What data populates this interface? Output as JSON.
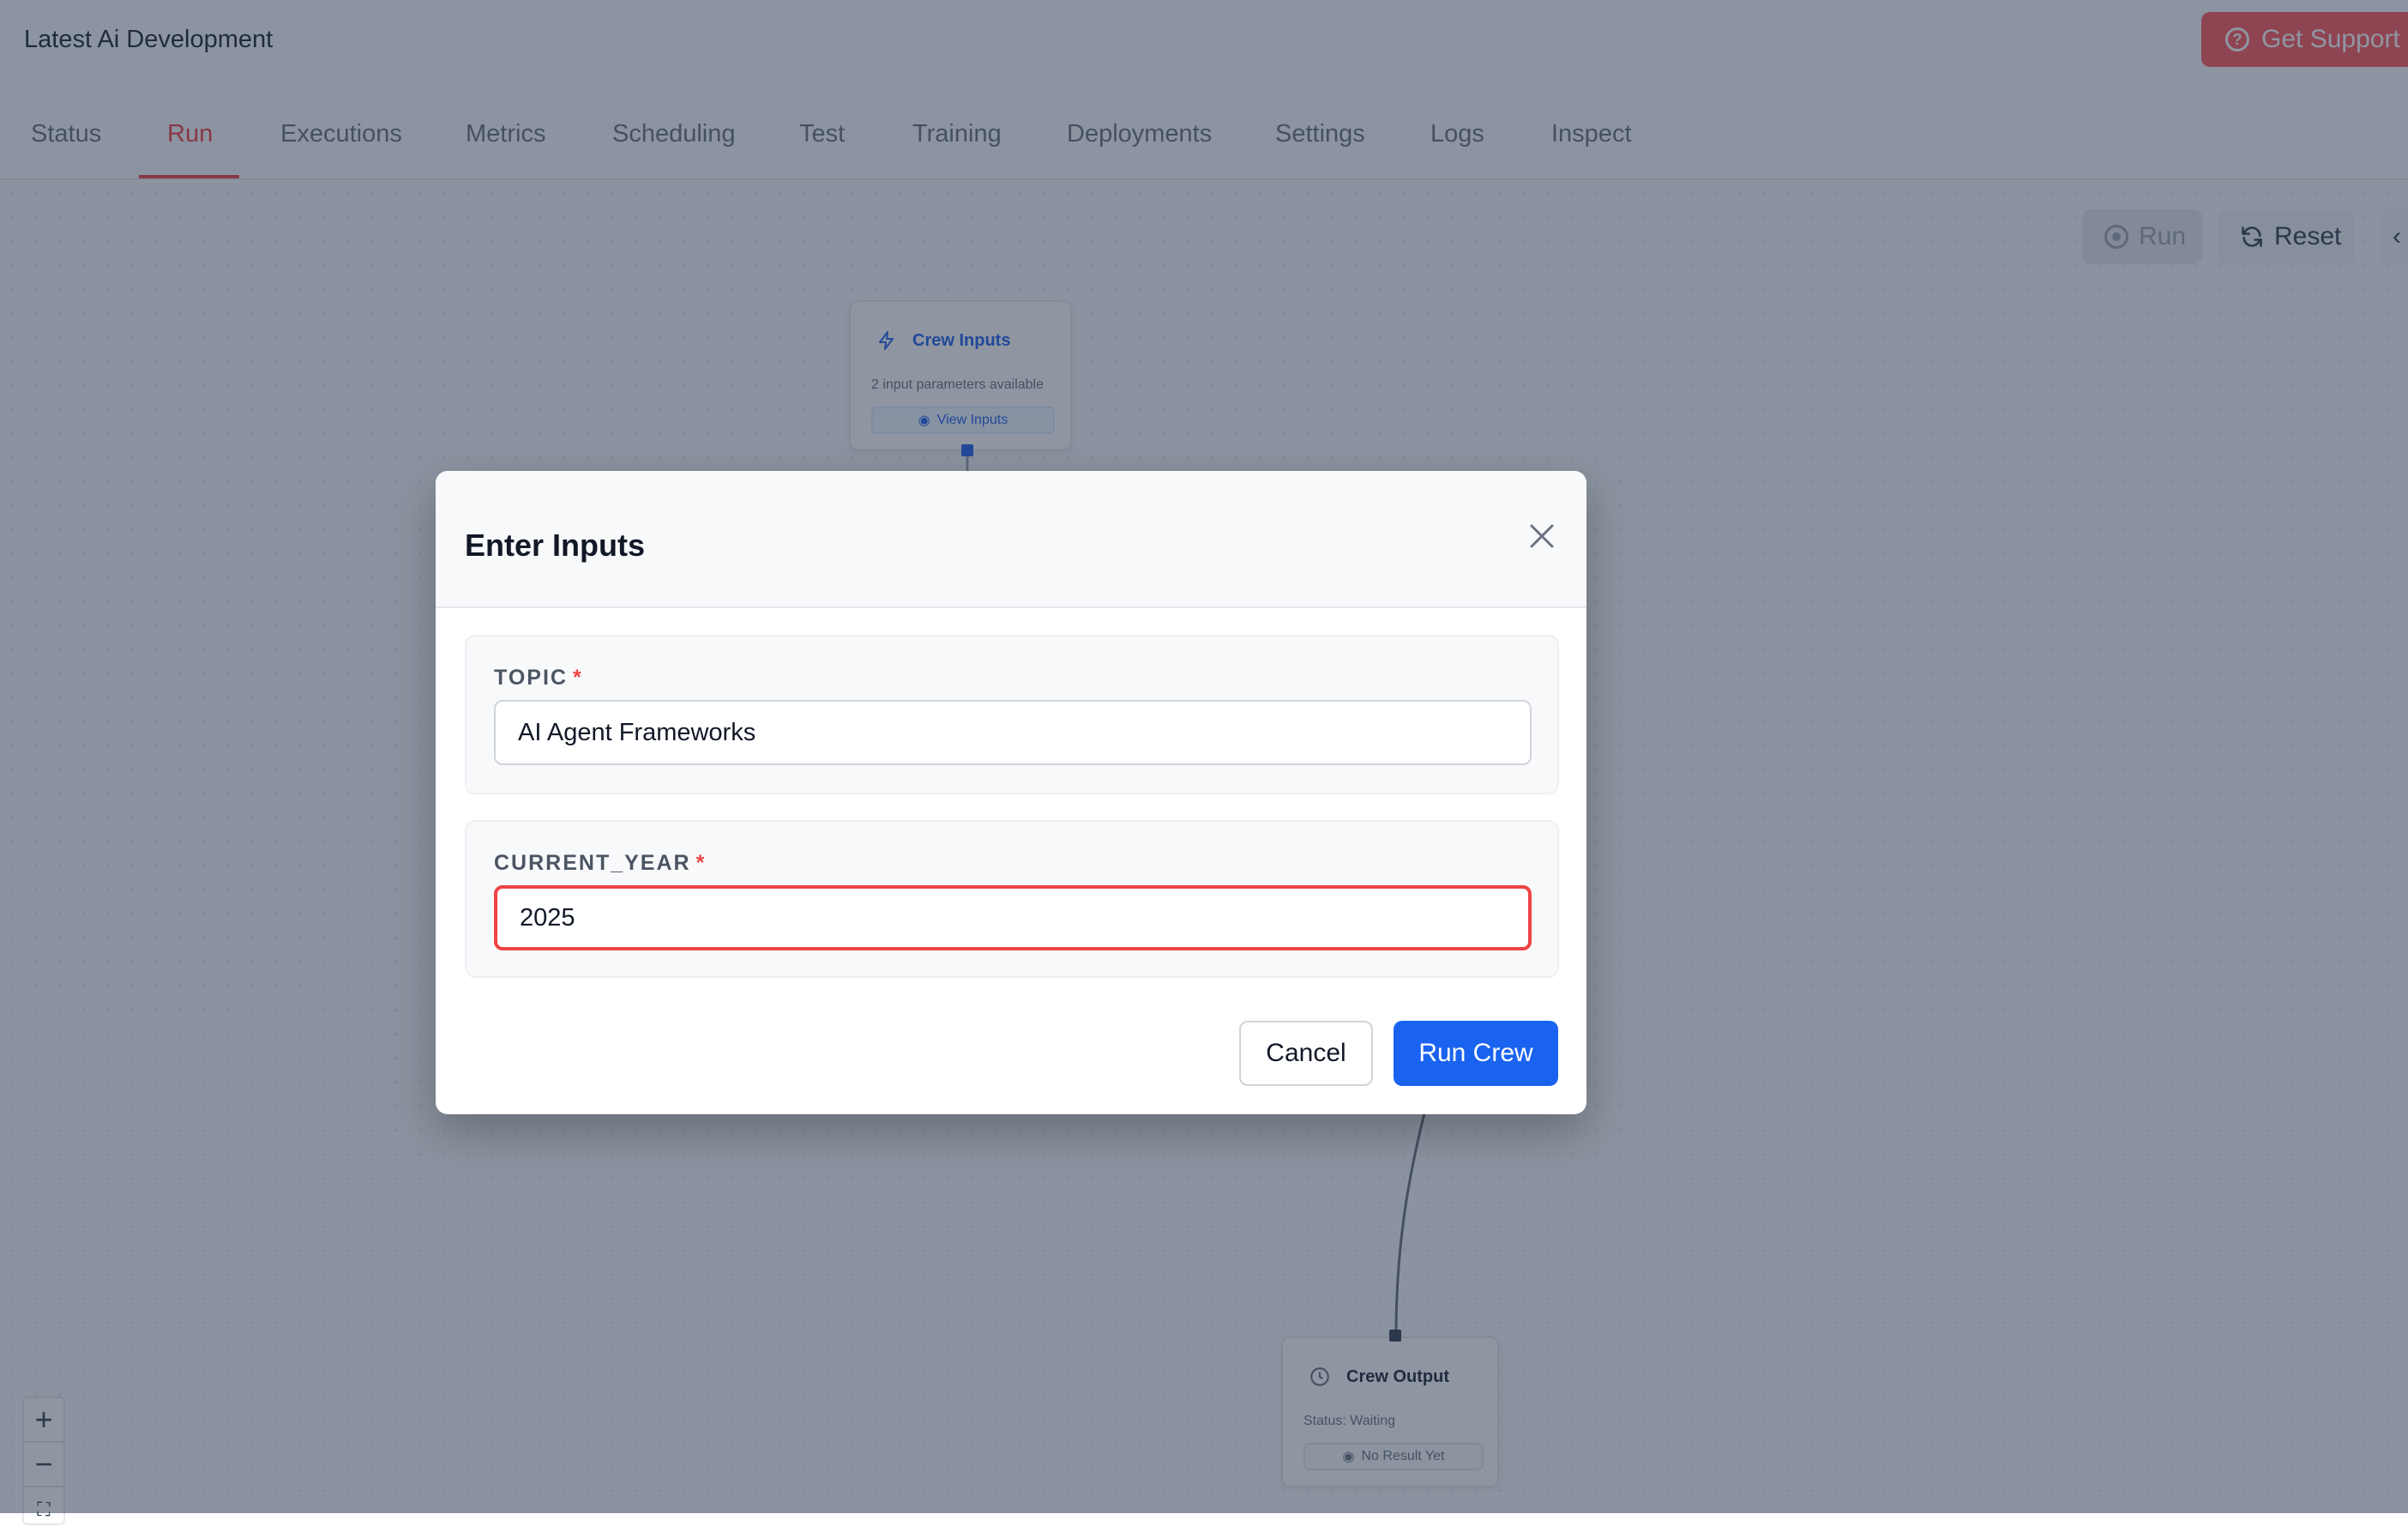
{
  "header": {
    "app_title": "Latest Ai Development",
    "support_label": "Get Support",
    "support_icon": "question-circle-icon",
    "accent_color": "#ff5a5f"
  },
  "tabs": [
    {
      "label": "Status",
      "active": false
    },
    {
      "label": "Run",
      "active": true
    },
    {
      "label": "Executions",
      "active": false
    },
    {
      "label": "Metrics",
      "active": false
    },
    {
      "label": "Scheduling",
      "active": false
    },
    {
      "label": "Test",
      "active": false
    },
    {
      "label": "Training",
      "active": false
    },
    {
      "label": "Deployments",
      "active": false
    },
    {
      "label": "Settings",
      "active": false
    },
    {
      "label": "Logs",
      "active": false
    },
    {
      "label": "Inspect",
      "active": false
    }
  ],
  "toolbar": {
    "run_label": "Run",
    "reset_label": "Reset"
  },
  "canvas": {
    "crew_inputs_node": {
      "title": "Crew Inputs",
      "subtitle": "2 input parameters available",
      "button_label": "View Inputs",
      "icon": "lightning-icon"
    },
    "crew_output_node": {
      "title": "Crew Output",
      "status_text": "Status: Waiting",
      "button_label": "No Result Yet",
      "icon": "clock-icon"
    },
    "zoom_controls": [
      "zoom-in",
      "zoom-out",
      "fit-view"
    ]
  },
  "modal": {
    "title": "Enter Inputs",
    "fields": [
      {
        "label": "TOPIC",
        "required_mark": "*",
        "value": "AI Agent Frameworks",
        "error": false
      },
      {
        "label": "CURRENT_YEAR",
        "required_mark": "*",
        "value": "2025",
        "error": true
      }
    ],
    "cancel_label": "Cancel",
    "submit_label": "Run Crew",
    "primary_color": "#1a63f0",
    "error_color": "#ef4444"
  }
}
